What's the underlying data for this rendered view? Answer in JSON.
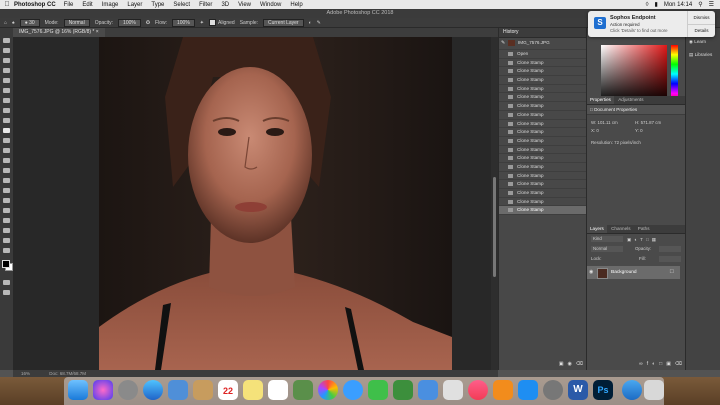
{
  "menubar": {
    "app_name": "Photoshop CC",
    "items": [
      "File",
      "Edit",
      "Image",
      "Layer",
      "Type",
      "Select",
      "Filter",
      "3D",
      "View",
      "Window",
      "Help"
    ],
    "clock": "Mon 14:14"
  },
  "window": {
    "title": "Adobe Photoshop CC 2018"
  },
  "options_bar": {
    "mode_label": "Mode:",
    "mode_value": "Normal",
    "opacity_label": "Opacity:",
    "opacity_value": "100%",
    "flow_label": "Flow:",
    "flow_value": "100%",
    "aligned_label": "Aligned",
    "sample_label": "Sample:",
    "sample_value": "Current Layer"
  },
  "document": {
    "tab_label": "IMG_7576.JPG @ 16% (RGB/8) *",
    "zoom": "16%",
    "doc_info": "Doc: 68.7M/68.7M"
  },
  "history": {
    "title": "History",
    "snapshot": "IMG_7576.JPG",
    "steps": [
      "Open",
      "Clone Stamp",
      "Clone Stamp",
      "Clone Stamp",
      "Clone Stamp",
      "Clone Stamp",
      "Clone Stamp",
      "Clone Stamp",
      "Clone Stamp",
      "Clone Stamp",
      "Clone Stamp",
      "Clone Stamp",
      "Clone Stamp",
      "Clone Stamp",
      "Clone Stamp",
      "Clone Stamp",
      "Clone Stamp",
      "Clone Stamp",
      "Clone Stamp"
    ]
  },
  "properties": {
    "tabs": [
      "Properties",
      "Adjustments"
    ],
    "section": "Document Properties",
    "w_label": "W: 101.11 cm",
    "h_label": "H: 571.87 cm",
    "x_label": "X: 0",
    "y_label": "Y: 0",
    "resolution": "Resolution: 72 pixels/inch"
  },
  "layers": {
    "tabs": [
      "Layers",
      "Channels",
      "Paths"
    ],
    "kind": "Kind",
    "blend": "Normal",
    "opacity": "Opacity:",
    "lock": "Lock:",
    "fill": "Fill:",
    "layer_name": "Background"
  },
  "far_right": {
    "items": [
      "Learn",
      "Libraries"
    ]
  },
  "notification": {
    "title": "Sophos Endpoint",
    "line1": "Action required",
    "line2": "Click 'Details' to find out more",
    "dismiss": "Dismiss",
    "details": "Details"
  },
  "colors": {
    "accent_selected": "#6b6b6b",
    "ps_blue": "#31a8ff"
  }
}
